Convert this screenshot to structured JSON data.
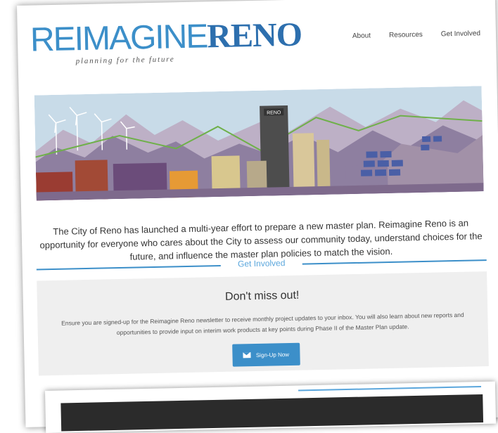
{
  "logo": {
    "part1": "REIMAGINE",
    "part2": "RENO",
    "tagline": "planning for the future"
  },
  "nav": {
    "about": "About",
    "resources": "Resources",
    "get_involved": "Get Involved"
  },
  "hero": {
    "building_sign": "RENO"
  },
  "intro": {
    "text": "The City of Reno has launched a multi-year effort to prepare a new master plan. Reimagine Reno is an opportunity for everyone who cares about the City to assess our community today, understand choices for the future, and influence the master plan policies to match the vision."
  },
  "section": {
    "heading": "Get Involved"
  },
  "signup_box": {
    "title": "Don't miss out!",
    "text": "Ensure you are signed-up for the Reimagine Reno newsletter to receive monthly project updates to your inbox. You will also learn about new reports and opportunities to provide input on interim work products at key points during Phase II of the Master Plan update.",
    "button_label": "Sign-Up Now"
  },
  "colors": {
    "brand_blue": "#3c8fc9",
    "dark_blue": "#2d6fae",
    "panel_gray": "#efefef"
  }
}
